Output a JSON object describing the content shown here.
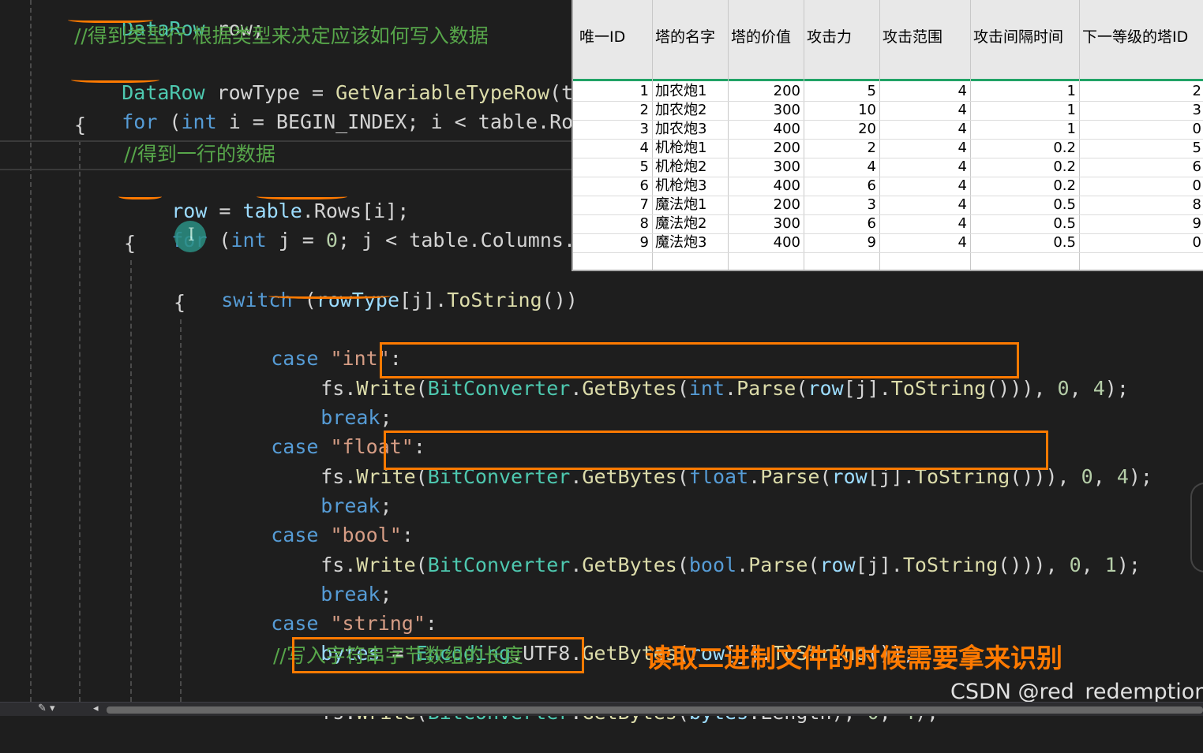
{
  "code": {
    "line0": [
      "DataRow",
      " row;"
    ],
    "line1": "//得到类型行 根据类型来决定应该如何写入数据",
    "line2": [
      "DataRow",
      " rowType = ",
      "GetVariableTypeRow",
      "(tab"
    ],
    "line3": [
      "for",
      " (",
      "int",
      " i = BEGIN_INDEX; i < table.",
      "Rows"
    ],
    "line4": "{",
    "line5": "//得到一行的数据",
    "line6": [
      "row",
      " = ",
      "table",
      ".",
      "Rows",
      "[i];"
    ],
    "line7": [
      "for",
      " (",
      "int",
      " j = ",
      "0",
      "; j < table.",
      "Columns",
      ".Co"
    ],
    "line8": "{",
    "line9": [
      "switch",
      " (",
      "rowType",
      "[j].",
      "ToString",
      "())"
    ],
    "line10": "{",
    "line11": [
      "case",
      " ",
      "\"int\"",
      ":"
    ],
    "line12": [
      "fs.",
      "Write",
      "(",
      "BitConverter",
      ".",
      "GetBytes",
      "(",
      "int",
      ".",
      "Parse",
      "(",
      "row",
      "[j].",
      "ToString",
      "())), ",
      "0",
      ", ",
      "4",
      ");"
    ],
    "line13": [
      "break",
      ";"
    ],
    "line14": [
      "case",
      " ",
      "\"float\"",
      ":"
    ],
    "line15": [
      "fs.",
      "Write",
      "(",
      "BitConverter",
      ".",
      "GetBytes",
      "(",
      "float",
      ".",
      "Parse",
      "(",
      "row",
      "[j].",
      "ToString",
      "())), ",
      "0",
      ", ",
      "4",
      ");"
    ],
    "line16": [
      "break",
      ";"
    ],
    "line17": [
      "case",
      " ",
      "\"bool\"",
      ":"
    ],
    "line18": [
      "fs.",
      "Write",
      "(",
      "BitConverter",
      ".",
      "GetBytes",
      "(",
      "bool",
      ".",
      "Parse",
      "(",
      "row",
      "[j].",
      "ToString",
      "())), ",
      "0",
      ", ",
      "1",
      ");"
    ],
    "line19": [
      "break",
      ";"
    ],
    "line20": [
      "case",
      " ",
      "\"string\"",
      ":"
    ],
    "line21": [
      "bytes",
      " = ",
      "Encoding",
      ".UTF8.",
      "GetBytes",
      "(",
      "row",
      "[j].",
      "ToString",
      "());"
    ],
    "line22": "//写入字符串字节数组的长度",
    "line23": [
      "fs.",
      "Write",
      "(",
      "BitConverter",
      ".",
      "GetBytes",
      "(",
      "bytes",
      ".Length), ",
      "0",
      ", ",
      "4",
      ");"
    ]
  },
  "sheet": {
    "headers": [
      "唯一ID",
      "塔的名字",
      "塔的价值",
      "攻击力",
      "攻击范围",
      "攻击间隔时间",
      "下一等级的塔ID"
    ],
    "rows": [
      [
        "1",
        "加农炮1",
        "200",
        "5",
        "4",
        "1",
        "2"
      ],
      [
        "2",
        "加农炮2",
        "300",
        "10",
        "4",
        "1",
        "3"
      ],
      [
        "3",
        "加农炮3",
        "400",
        "20",
        "4",
        "1",
        "0"
      ],
      [
        "4",
        "机枪炮1",
        "200",
        "2",
        "4",
        "0.2",
        "5"
      ],
      [
        "5",
        "机枪炮2",
        "300",
        "4",
        "4",
        "0.2",
        "6"
      ],
      [
        "6",
        "机枪炮3",
        "400",
        "6",
        "4",
        "0.2",
        "0"
      ],
      [
        "7",
        "魔法炮1",
        "200",
        "3",
        "4",
        "0.5",
        "8"
      ],
      [
        "8",
        "魔法炮2",
        "300",
        "6",
        "4",
        "0.5",
        "9"
      ],
      [
        "9",
        "魔法炮3",
        "400",
        "9",
        "4",
        "0.5",
        "0"
      ]
    ]
  },
  "annotation": {
    "caption": "读取二进制文件的时候需要拿来识别",
    "watermark": "CSDN @red_redemption",
    "cursor_glyph": "I"
  },
  "statusbar": {
    "tool_glyph": "✎ ▾",
    "arrow_glyph": "◂"
  },
  "colors": {
    "accent": "#ff7a00",
    "editor_bg": "#1e1e1e",
    "keyword": "#569cd6",
    "type": "#4ec9b0",
    "string": "#d69d85",
    "comment": "#57a64a",
    "sheet_selection": "#21a366"
  }
}
